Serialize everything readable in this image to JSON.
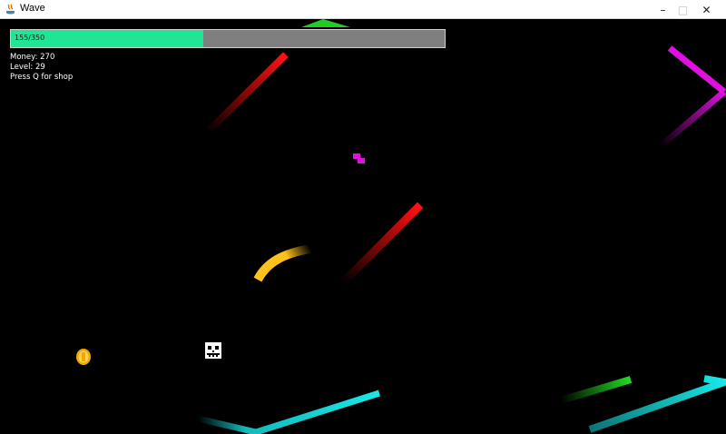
{
  "window": {
    "title": "Wave",
    "minimize_icon": "minimize-icon",
    "maximize_icon": "maximize-icon",
    "close_icon": "close-icon"
  },
  "hud": {
    "health_label": "155/350",
    "health_value": 155,
    "health_max": 350,
    "health_color": "#1fe695",
    "health_track_color": "#7f7f7f",
    "money": "Money: 270",
    "level": "Level: 29",
    "shop_hint": "Press Q for shop"
  },
  "entities": {
    "player_icon": "skull-face-icon",
    "coin_icon": "coin-icon",
    "enemy_colors": {
      "red": "#ff1010",
      "magenta": "#e010e0",
      "green": "#22dd22",
      "cyan": "#18e8e8",
      "yellow": "#ffc21a"
    }
  }
}
